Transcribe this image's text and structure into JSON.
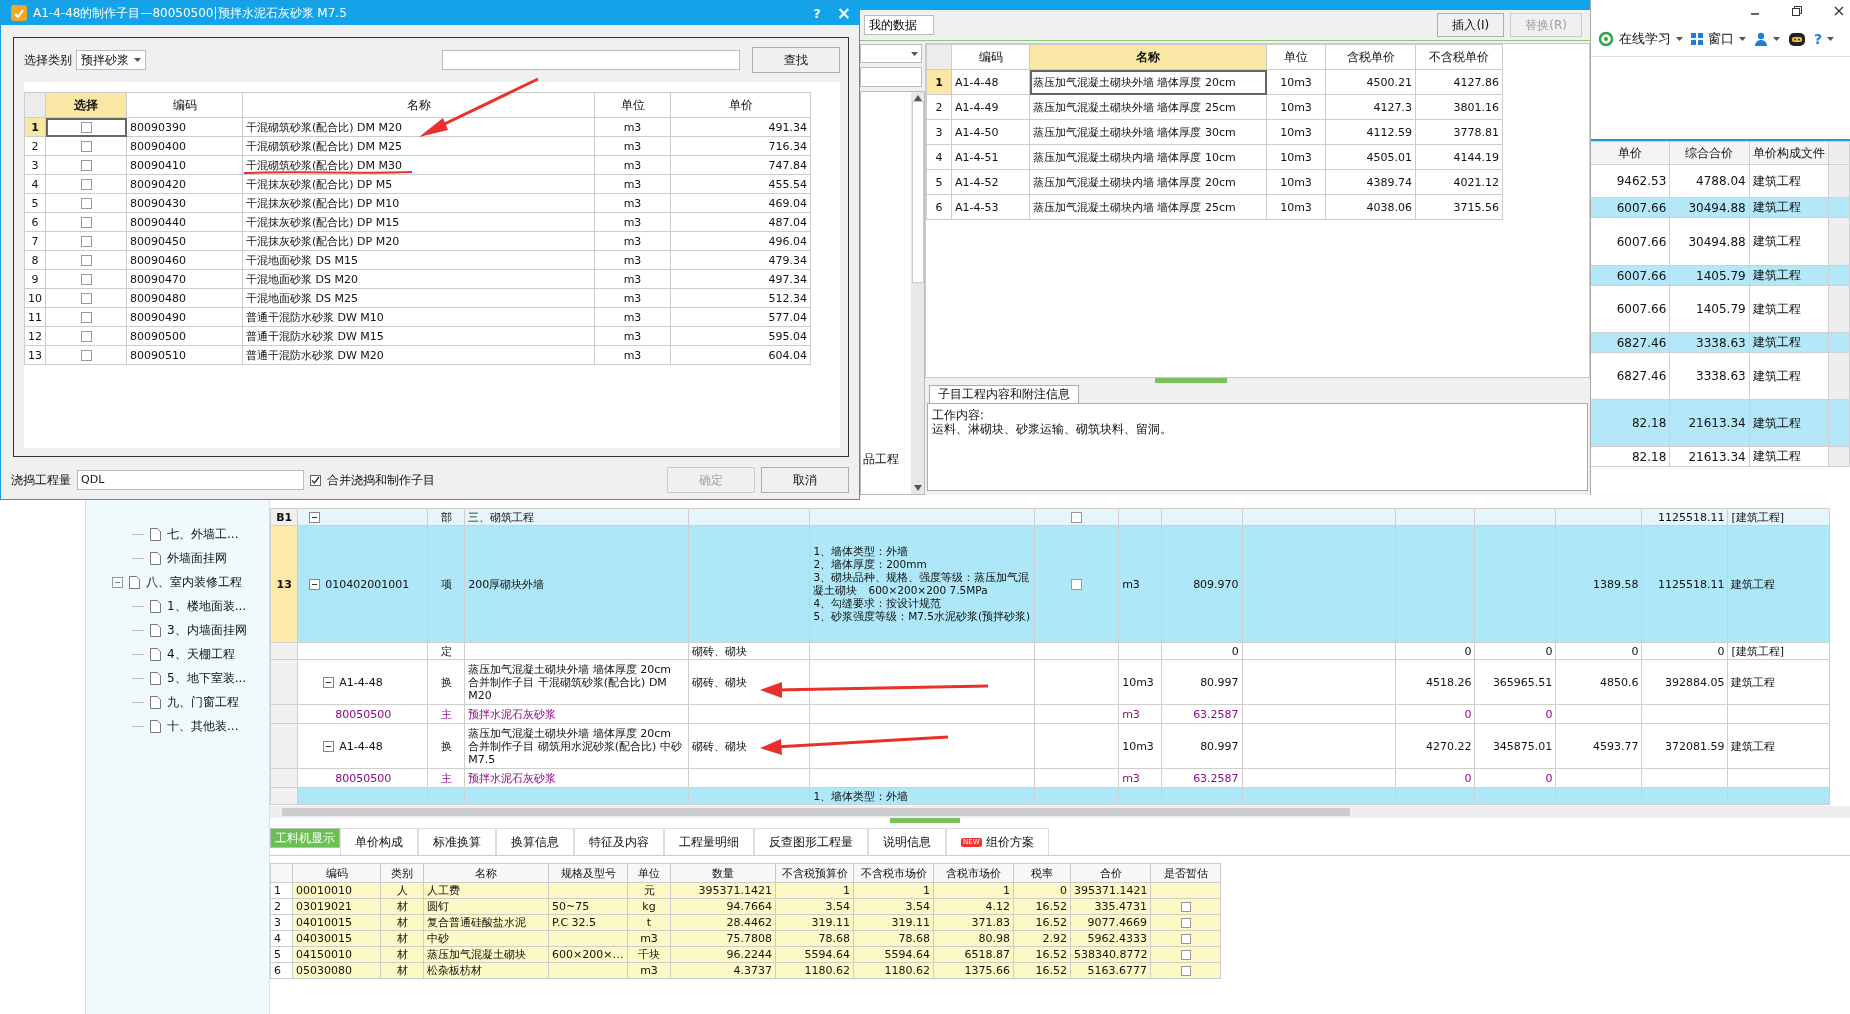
{
  "dialog": {
    "title": "A1-4-48的制作子目—80050500|预拌水泥石灰砂浆 M7.5",
    "help": "?",
    "close": "×",
    "category_label": "选择类别",
    "category": "预拌砂浆",
    "search_button": "查找",
    "columns": [
      "选择",
      "编码",
      "名称",
      "单位",
      "单价"
    ],
    "rows": [
      {
        "no": "1",
        "code": "80090390",
        "name": "干混砌筑砂浆(配合比) DM M20",
        "unit": "m3",
        "price": "491.34",
        "checked": false,
        "selected": true
      },
      {
        "no": "2",
        "code": "80090400",
        "name": "干混砌筑砂浆(配合比) DM M25",
        "unit": "m3",
        "price": "716.34",
        "checked": false,
        "selected": false
      },
      {
        "no": "3",
        "code": "80090410",
        "name": "干混砌筑砂浆(配合比) DM M30",
        "unit": "m3",
        "price": "747.84",
        "checked": false,
        "selected": false
      },
      {
        "no": "4",
        "code": "80090420",
        "name": "干混抹灰砂浆(配合比) DP M5",
        "unit": "m3",
        "price": "455.54",
        "checked": false,
        "selected": false
      },
      {
        "no": "5",
        "code": "80090430",
        "name": "干混抹灰砂浆(配合比) DP M10",
        "unit": "m3",
        "price": "469.04",
        "checked": false,
        "selected": false
      },
      {
        "no": "6",
        "code": "80090440",
        "name": "干混抹灰砂浆(配合比) DP M15",
        "unit": "m3",
        "price": "487.04",
        "checked": false,
        "selected": false
      },
      {
        "no": "7",
        "code": "80090450",
        "name": "干混抹灰砂浆(配合比) DP M20",
        "unit": "m3",
        "price": "496.04",
        "checked": false,
        "selected": false
      },
      {
        "no": "8",
        "code": "80090460",
        "name": "干混地面砂浆 DS M15",
        "unit": "m3",
        "price": "479.34",
        "checked": false,
        "selected": false
      },
      {
        "no": "9",
        "code": "80090470",
        "name": "干混地面砂浆 DS M20",
        "unit": "m3",
        "price": "497.34",
        "checked": false,
        "selected": false
      },
      {
        "no": "10",
        "code": "80090480",
        "name": "干混地面砂浆 DS M25",
        "unit": "m3",
        "price": "512.34",
        "checked": false,
        "selected": false
      },
      {
        "no": "11",
        "code": "80090490",
        "name": "普通干混防水砂浆 DW M10",
        "unit": "m3",
        "price": "577.04",
        "checked": false,
        "selected": false
      },
      {
        "no": "12",
        "code": "80090500",
        "name": "普通干混防水砂浆 DW M15",
        "unit": "m3",
        "price": "595.04",
        "checked": false,
        "selected": false
      },
      {
        "no": "13",
        "code": "80090510",
        "name": "普通干混防水砂浆 DW M20",
        "unit": "m3",
        "price": "604.04",
        "checked": false,
        "selected": false
      }
    ],
    "quantity_label": "浇捣工程量",
    "quantity": "QDL",
    "merge": {
      "label": "合并浇捣和制作子目",
      "checked": true
    },
    "ok_button": {
      "label": "确定",
      "disabled": true
    },
    "cancel_button": {
      "label": "取消",
      "disabled": false
    }
  },
  "library": {
    "tabs": [
      {
        "label": "我的数据",
        "selected": true
      }
    ],
    "insert_button": {
      "label": "插入(I)",
      "disabled": false
    },
    "replace_button": {
      "label": "替换(R)",
      "disabled": true
    },
    "tree_text": "品工程",
    "columns": [
      "编码",
      "名称",
      "单位",
      "含税单价",
      "不含税单价"
    ],
    "rows": [
      {
        "no": "1",
        "code": "A1-4-48",
        "name": "蒸压加气混凝土砌块外墙 墙体厚度 20cm",
        "unit": "10m3",
        "price": "4500.21",
        "net_price": "4127.86",
        "selected": true
      },
      {
        "no": "2",
        "code": "A1-4-49",
        "name": "蒸压加气混凝土砌块外墙 墙体厚度 25cm",
        "unit": "10m3",
        "price": "4127.3",
        "net_price": "3801.16",
        "selected": false
      },
      {
        "no": "3",
        "code": "A1-4-50",
        "name": "蒸压加气混凝土砌块外墙 墙体厚度 30cm",
        "unit": "10m3",
        "price": "4112.59",
        "net_price": "3778.81",
        "selected": false
      },
      {
        "no": "4",
        "code": "A1-4-51",
        "name": "蒸压加气混凝土砌块内墙 墙体厚度 10cm",
        "unit": "10m3",
        "price": "4505.01",
        "net_price": "4144.19",
        "selected": false
      },
      {
        "no": "5",
        "code": "A1-4-52",
        "name": "蒸压加气混凝土砌块内墙 墙体厚度 20cm",
        "unit": "10m3",
        "price": "4389.74",
        "net_price": "4021.12",
        "selected": false
      },
      {
        "no": "6",
        "code": "A1-4-53",
        "name": "蒸压加气混凝土砌块内墙 墙体厚度 25cm",
        "unit": "10m3",
        "price": "4038.06",
        "net_price": "3715.56",
        "selected": false
      }
    ],
    "info_tab": "子目工程内容和附注信息",
    "info_text": "工作内容:\n运料、淋砌块、砂浆运输、砌筑块料、留洞。"
  },
  "toolbar": {
    "items": [
      {
        "kind": "learn",
        "label": "在线学习"
      },
      {
        "kind": "window",
        "label": "窗口"
      },
      {
        "kind": "user"
      },
      {
        "kind": "robot"
      },
      {
        "kind": "help",
        "label": "?"
      }
    ]
  },
  "summary_table": {
    "columns": [
      "单价",
      "综合合价",
      "单价构成文件"
    ],
    "rows": [
      {
        "price": "9462.53",
        "total": "4788.04",
        "file": "建筑工程",
        "highlight": false
      },
      {
        "price": "6007.66",
        "total": "30494.88",
        "file": "建筑工程",
        "highlight": true
      },
      {
        "price": "6007.66",
        "total": "30494.88",
        "file": "建筑工程",
        "highlight": false
      },
      {
        "price": "6007.66",
        "total": "1405.79",
        "file": "建筑工程",
        "highlight": true
      },
      {
        "price": "6007.66",
        "total": "1405.79",
        "file": "建筑工程",
        "highlight": false
      },
      {
        "price": "6827.46",
        "total": "3338.63",
        "file": "建筑工程",
        "highlight": true
      },
      {
        "price": "6827.46",
        "total": "3338.63",
        "file": "建筑工程",
        "highlight": false
      },
      {
        "price": "82.18",
        "total": "21613.34",
        "file": "建筑工程",
        "highlight": true
      },
      {
        "price": "82.18",
        "total": "21613.34",
        "file": "建筑工程",
        "highlight": false
      }
    ]
  },
  "tree": {
    "items": [
      {
        "children": [
          {
            "label": "七、外墙工..."
          },
          {
            "label": "外墙面挂网"
          }
        ]
      },
      {
        "label": "八、室内装修工程",
        "expanded": true,
        "children": [
          {
            "label": "1、楼地面装..."
          },
          {
            "label": "3、内墙面挂网"
          },
          {
            "label": "4、天棚工程"
          },
          {
            "label": "5、地下室装..."
          },
          {
            "label": "九、门窗工程"
          },
          {
            "label": "十、其他装..."
          }
        ]
      }
    ]
  },
  "grid": {
    "rows": [
      {
        "kind": "section",
        "no": "B1",
        "type": "部",
        "name": "三、砌筑工程",
        "checked": false,
        "total": "1125518.11",
        "file": "[建筑工程]",
        "selected": false
      },
      {
        "kind": "item",
        "no": "13",
        "code": "010402001001",
        "type": "项",
        "name": "200厚砌块外墙",
        "features": "1、墙体类型：外墙\n2、墙体厚度：200mm\n3、砌块品种、规格、强度等级：蒸压加气混凝土砌块　600×200×200 7.5MPa\n4、勾缝要求：按设计规范\n5、砂浆强度等级：M7.5水泥砂浆(预拌砂浆)",
        "checked": false,
        "unit": "m3",
        "quantity": "809.970",
        "column_13": "1389.58",
        "total": "1125518.11",
        "file": "建筑工程",
        "selected": true
      },
      {
        "kind": "quota",
        "type": "定",
        "content": "砌砖、砌块",
        "quantity": "0",
        "column_11": "0",
        "column_12": "0",
        "column_13": "0",
        "total": "0",
        "file": "[建筑工程]",
        "selected": false
      },
      {
        "kind": "conversion",
        "code": "A1-4-48",
        "type": "换",
        "name": "蒸压加气混凝土砌块外墙 墙体厚度 20cm 合并制作子目 干混砌筑砂浆(配合比) DM M20",
        "content": "砌砖、砌块",
        "unit": "10m3",
        "quantity": "80.997",
        "column_11": "4518.26",
        "column_12": "365965.51",
        "column_13": "4850.6",
        "total": "392884.05",
        "file": "建筑工程",
        "selected": false
      },
      {
        "kind": "material",
        "code": "80050500",
        "type": "主",
        "name": "预拌水泥石灰砂浆",
        "unit": "m3",
        "quantity": "63.2587",
        "column_11": "0",
        "column_12": "0",
        "selected": false
      },
      {
        "kind": "conversion",
        "code": "A1-4-48",
        "type": "换",
        "name": "蒸压加气混凝土砌块外墙 墙体厚度 20cm 合并制作子目 砌筑用水泥砂浆(配合比) 中砂 M7.5",
        "content": "砌砖、砌块",
        "unit": "10m3",
        "quantity": "80.997",
        "column_11": "4270.22",
        "column_12": "345875.01",
        "column_13": "4593.77",
        "total": "372081.59",
        "file": "建筑工程",
        "selected": false
      },
      {
        "kind": "material",
        "code": "80050500",
        "type": "主",
        "name": "预拌水泥石灰砂浆",
        "unit": "m3",
        "quantity": "63.2587",
        "column_11": "0",
        "column_12": "0",
        "selected": false
      },
      {
        "kind": "partial",
        "features": "1、墙体类型：外墙",
        "selected": false
      }
    ]
  },
  "detail_tabs": [
    {
      "label": "工料机显示",
      "selected": true
    },
    {
      "label": "单价构成",
      "selected": false
    },
    {
      "label": "标准换算",
      "selected": false
    },
    {
      "label": "换算信息",
      "selected": false
    },
    {
      "label": "特征及内容",
      "selected": false
    },
    {
      "label": "工程量明细",
      "selected": false
    },
    {
      "label": "反查图形工程量",
      "selected": false
    },
    {
      "label": "说明信息",
      "selected": false
    },
    {
      "label": "组价方案",
      "badge": "NEW",
      "selected": false
    }
  ],
  "resources": {
    "columns": [
      "编码",
      "类别",
      "名称",
      "规格及型号",
      "单位",
      "数量",
      "不含税预算价",
      "不含税市场价",
      "含税市场价",
      "税率",
      "合价",
      "是否暂估"
    ],
    "rows": [
      {
        "no": "1",
        "code": "00010010",
        "category": "人",
        "name": "人工费",
        "unit": "元",
        "quantity": "395371.1421",
        "budget_price": "1",
        "market_price": "1",
        "tax_price": "1",
        "tax_rate": "0",
        "total": "395371.1421"
      },
      {
        "no": "2",
        "code": "03019021",
        "category": "材",
        "name": "圆钉",
        "spec": "50~75",
        "unit": "kg",
        "quantity": "94.7664",
        "budget_price": "3.54",
        "market_price": "3.54",
        "tax_price": "4.12",
        "tax_rate": "16.52",
        "total": "335.4731",
        "checked": false
      },
      {
        "no": "3",
        "code": "04010015",
        "category": "材",
        "name": "复合普通硅酸盐水泥",
        "spec": "P.C 32.5",
        "unit": "t",
        "quantity": "28.4462",
        "budget_price": "319.11",
        "market_price": "319.11",
        "tax_price": "371.83",
        "tax_rate": "16.52",
        "total": "9077.4669",
        "checked": false
      },
      {
        "no": "4",
        "code": "04030015",
        "category": "材",
        "name": "中砂",
        "unit": "m3",
        "quantity": "75.7808",
        "budget_price": "78.68",
        "market_price": "78.68",
        "tax_price": "80.98",
        "tax_rate": "2.92",
        "total": "5962.4333",
        "checked": false
      },
      {
        "no": "5",
        "code": "04150010",
        "category": "材",
        "name": "蒸压加气混凝土砌块",
        "spec": "600×200×…",
        "unit": "千块",
        "quantity": "96.2244",
        "budget_price": "5594.64",
        "market_price": "5594.64",
        "tax_price": "6518.87",
        "tax_rate": "16.52",
        "total": "538340.8772",
        "checked": false
      },
      {
        "no": "6",
        "code": "05030080",
        "category": "材",
        "name": "松杂板枋材",
        "unit": "m3",
        "quantity": "4.3737",
        "budget_price": "1180.62",
        "market_price": "1180.62",
        "tax_price": "1375.66",
        "tax_rate": "16.52",
        "total": "5163.6777",
        "checked": false
      }
    ]
  }
}
